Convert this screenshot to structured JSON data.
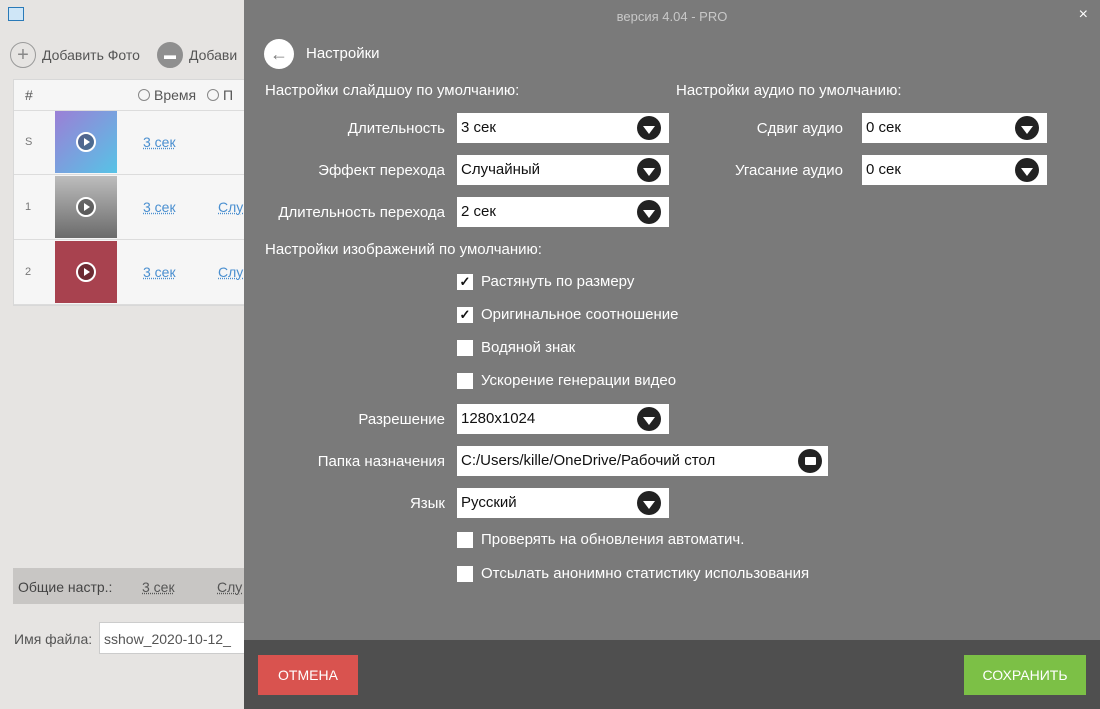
{
  "background_app": {
    "toolbar": {
      "add_photo": "Добавить Фото",
      "add_folder": "Добави"
    },
    "list": {
      "headers": {
        "num": "#",
        "time": "Время",
        "transition": "П"
      },
      "rows": [
        {
          "num": "S",
          "duration": "3 сек",
          "effect": "",
          "thumb_color": "#6fa8dc"
        },
        {
          "num": "1",
          "duration": "3 сек",
          "effect": "Слу",
          "thumb_color": "#8a8a8a"
        },
        {
          "num": "2",
          "duration": "3 сек",
          "effect": "Слу",
          "thumb_color": "#a8424f"
        }
      ]
    },
    "general": {
      "label": "Общие настр.:",
      "duration": "3 сек",
      "effect": "Слу"
    },
    "filename": {
      "label": "Имя файла:",
      "value": "sshow_2020-10-12_"
    }
  },
  "dialog": {
    "version": "версия 4.04 - PRO",
    "close": "×",
    "title": "Настройки",
    "slideshow": {
      "heading": "Настройки слайдшоу по умолчанию:",
      "duration_label": "Длительность",
      "duration_value": "3 сек",
      "transition_label": "Эффект перехода",
      "transition_value": "Случайный",
      "transition_duration_label": "Длительность перехода",
      "transition_duration_value": "2 сек"
    },
    "audio": {
      "heading": "Настройки аудио по умолчанию:",
      "shift_label": "Сдвиг аудио",
      "shift_value": "0 сек",
      "fade_label": "Угасание аудио",
      "fade_value": "0 сек"
    },
    "images": {
      "heading": "Настройки изображений по умолчанию:",
      "stretch": "Растянуть по размеру",
      "aspect": "Оригинальное соотношение",
      "watermark": "Водяной знак",
      "accel": "Ускорение генерации видео"
    },
    "resolution_label": "Разрешение",
    "resolution_value": "1280x1024",
    "folder_label": "Папка назначения",
    "folder_value": "C:/Users/kille/OneDrive/Рабочий стол",
    "language_label": "Язык",
    "language_value": "Русский",
    "check_updates": "Проверять на обновления автоматич.",
    "send_stats": "Отсылать анонимно статистику использования",
    "cancel": "ОТМЕНА",
    "save": "СОХРАНИТЬ",
    "checkbox_states": {
      "stretch": true,
      "aspect": true,
      "watermark": false,
      "accel": false,
      "check_updates": false,
      "send_stats": false
    },
    "colors": {
      "dialog_bg": "#7a7a7a",
      "footer_bg": "#4f4f4f",
      "cancel": "#d9534f",
      "save": "#7cc046"
    }
  }
}
